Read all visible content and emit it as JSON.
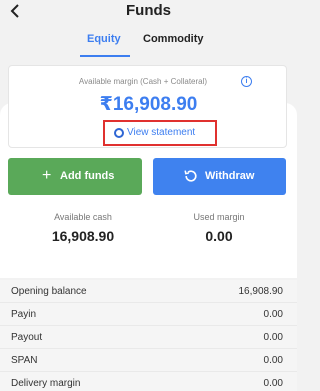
{
  "header": {
    "title": "Funds"
  },
  "tabs": [
    {
      "label": "Equity",
      "active": true
    },
    {
      "label": "Commodity",
      "active": false
    }
  ],
  "margin_card": {
    "label": "Available margin (Cash + Collateral)",
    "value": "₹16,908.90",
    "info_icon": "i",
    "view_statement_label": "View statement"
  },
  "actions": {
    "add_funds": {
      "label": "Add funds",
      "icon": "plus-icon",
      "glyph": "+"
    },
    "withdraw": {
      "label": "Withdraw",
      "icon": "refresh-icon"
    }
  },
  "summary": {
    "available_cash": {
      "label": "Available cash",
      "value": "16,908.90"
    },
    "used_margin": {
      "label": "Used margin",
      "value": "0.00"
    }
  },
  "breakdown": [
    {
      "label": "Opening balance",
      "value": "16,908.90"
    },
    {
      "label": "Payin",
      "value": "0.00"
    },
    {
      "label": "Payout",
      "value": "0.00"
    },
    {
      "label": "SPAN",
      "value": "0.00"
    },
    {
      "label": "Delivery margin",
      "value": "0.00"
    }
  ],
  "colors": {
    "accent": "#3d7ef0",
    "add_button": "#5aa959",
    "withdraw_button": "#3f82ef",
    "highlight_box": "#e0312f"
  }
}
